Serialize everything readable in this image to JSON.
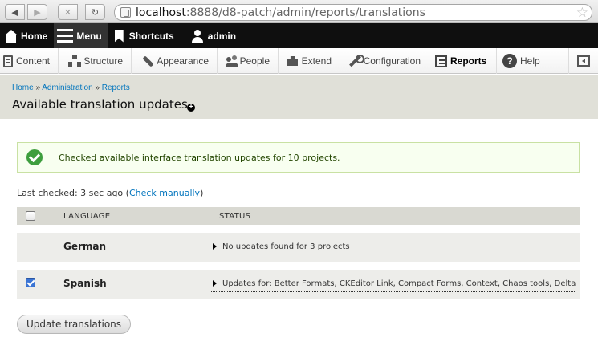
{
  "browser": {
    "url_host": "localhost",
    "url_path": ":8888/d8-patch/admin/reports/translations",
    "back": "◀",
    "forward": "▶",
    "stop": "✕",
    "reload": "↻",
    "star": "☆"
  },
  "toolbar": {
    "home": "Home",
    "menu": "Menu",
    "shortcuts": "Shortcuts",
    "user": "admin"
  },
  "tray": {
    "items": [
      {
        "label": "Content"
      },
      {
        "label": "Structure"
      },
      {
        "label": "Appearance"
      },
      {
        "label": "People"
      },
      {
        "label": "Extend"
      },
      {
        "label": "Configuration"
      },
      {
        "label": "Reports",
        "active": true
      },
      {
        "label": "Help"
      }
    ],
    "help_glyph": "?"
  },
  "breadcrumb": {
    "home": "Home",
    "sep": " » ",
    "administration": "Administration",
    "reports": "Reports"
  },
  "page": {
    "title": "Available translation updates",
    "shortcut_glyph": "+"
  },
  "message": {
    "text": "Checked available interface translation updates for 10 projects."
  },
  "last_checked": {
    "prefix": "Last checked: 3 sec ago (",
    "link": "Check manually",
    "suffix": ")"
  },
  "table": {
    "headers": {
      "language": "LANGUAGE",
      "status": "STATUS"
    },
    "rows": [
      {
        "language": "German",
        "status": "No updates found for 3 projects",
        "checked": false
      },
      {
        "language": "Spanish",
        "status": "Updates for: Better Formats, CKEditor Link, Compact Forms, Context, Chaos tools, Delta API...",
        "checked": true
      }
    ]
  },
  "actions": {
    "update_button": "Update translations"
  },
  "colors": {
    "toolbar_bg": "#0f0f0f",
    "link": "#0074bd",
    "status_ok": "#3e9e3e"
  }
}
